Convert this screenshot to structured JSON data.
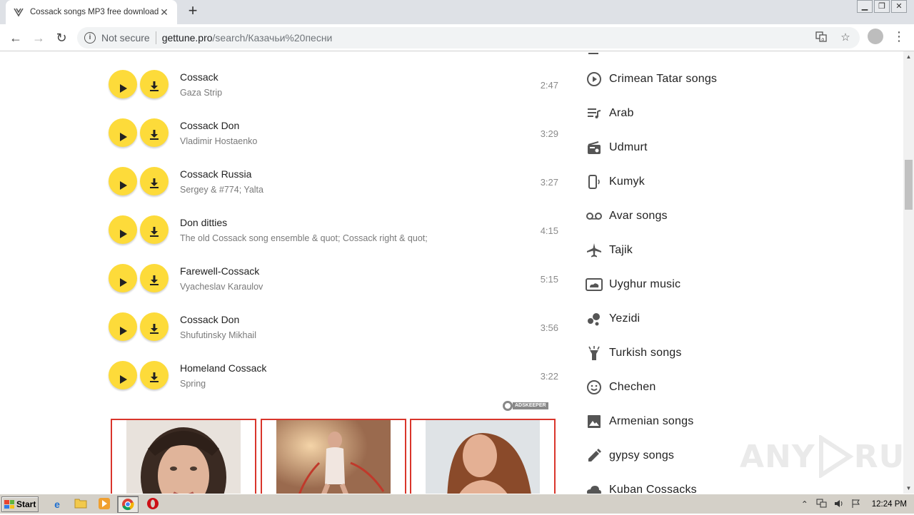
{
  "browser": {
    "tab_title": "Cossack songs MP3 free download a",
    "new_tab_symbol": "+",
    "url_security": "Not secure",
    "url_domain": "gettune.pro",
    "url_path": "/search/Казачьи%20песни"
  },
  "tracks": [
    {
      "title": "Cossack",
      "artist": "Gaza Strip",
      "duration": "2:47"
    },
    {
      "title": "Cossack Don",
      "artist": "Vladimir Hostaenko",
      "duration": "3:29"
    },
    {
      "title": "Cossack Russia",
      "artist": "Sergey & #774; Yalta",
      "duration": "3:27"
    },
    {
      "title": "Don ditties",
      "artist": "The old Cossack song ensemble & quot; Cossack right & quot;",
      "duration": "4:15"
    },
    {
      "title": "Farewell-Cossack",
      "artist": "Vyacheslav Karaulov",
      "duration": "5:15"
    },
    {
      "title": "Cossack Don",
      "artist": "Shufutinsky Mikhail",
      "duration": "3:56"
    },
    {
      "title": "Homeland Cossack",
      "artist": "Spring",
      "duration": "3:22"
    }
  ],
  "ads": {
    "logo_text": "ADSKEEPER"
  },
  "sidebar": {
    "items": [
      {
        "label": "Crimean Tatar songs",
        "icon": "play-circle-icon"
      },
      {
        "label": "Arab",
        "icon": "playlist-icon"
      },
      {
        "label": "Udmurt",
        "icon": "radio-icon"
      },
      {
        "label": "Kumyk",
        "icon": "phone-ringing-icon"
      },
      {
        "label": "Avar songs",
        "icon": "voicemail-icon"
      },
      {
        "label": "Tajik",
        "icon": "airplane-icon"
      },
      {
        "label": "Uyghur music",
        "icon": "cloud-photo-icon"
      },
      {
        "label": "Yezidi",
        "icon": "bubbles-icon"
      },
      {
        "label": "Turkish songs",
        "icon": "flashlight-icon"
      },
      {
        "label": "Chechen",
        "icon": "smiley-icon"
      },
      {
        "label": "Armenian songs",
        "icon": "image-icon"
      },
      {
        "label": "gypsy songs",
        "icon": "pencil-icon"
      },
      {
        "label": "Kuban Cossacks",
        "icon": "cloud-icon"
      }
    ]
  },
  "watermark": {
    "text_left": "ANY",
    "text_right": "RUN"
  },
  "taskbar": {
    "start_label": "Start",
    "clock": "12:24 PM"
  }
}
